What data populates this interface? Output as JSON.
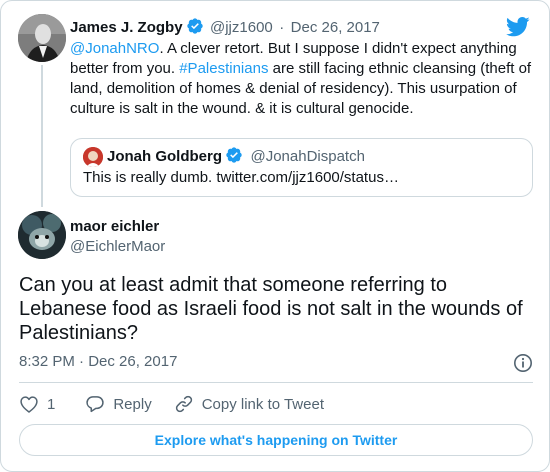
{
  "colors": {
    "accent": "#1d9bf0",
    "secondary_text": "#536471",
    "border": "#cfd9de"
  },
  "parent_tweet": {
    "author_name": "James J. Zogby",
    "handle": "@jjz1600",
    "separator": "·",
    "date": "Dec 26, 2017",
    "verified": true,
    "mention": "@JonahNRO",
    "text_part1": ". A clever retort.  But I suppose I didn't expect anything better from you. ",
    "hashtag": "#Palestinians",
    "text_part2": " are still facing ethnic cleansing (theft of land, demolition of homes & denial of residency). This usurpation of culture is salt in the wound. & it is cultural genocide."
  },
  "quoted_tweet": {
    "author_name": "Jonah Goldberg",
    "handle": "@JonahDispatch",
    "verified": true,
    "text": "This is really dumb. twitter.com/jjz1600/status…"
  },
  "main_tweet": {
    "author_name": "maor eichler",
    "handle": "@EichlerMaor",
    "text": "Can you at least admit that someone referring to Lebanese food as Israeli food is not salt in the wounds of Palestinians?",
    "time": "8:32 PM · Dec 26, 2017"
  },
  "actions": {
    "like_count": "1",
    "reply_label": "Reply",
    "copy_link_label": "Copy link to Tweet"
  },
  "explore_label": "Explore what's happening on Twitter",
  "icons": {
    "logo": "twitter-bird-icon",
    "verified": "verified-badge-icon",
    "info": "info-icon",
    "like": "heart-icon",
    "reply": "reply-bubble-icon",
    "copy_link": "link-icon"
  }
}
